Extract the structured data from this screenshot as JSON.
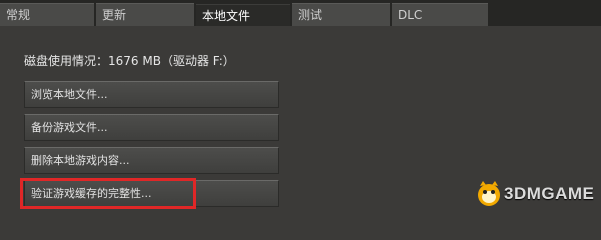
{
  "tabs": [
    {
      "label": "常规"
    },
    {
      "label": "更新"
    },
    {
      "label": "本地文件"
    },
    {
      "label": "测试"
    },
    {
      "label": "DLC"
    }
  ],
  "active_tab_index": 2,
  "disk_usage": "磁盘使用情况：1676 MB（驱动器 F:）",
  "buttons": {
    "browse": "浏览本地文件...",
    "backup": "备份游戏文件...",
    "delete": "删除本地游戏内容...",
    "verify": "验证游戏缓存的完整性..."
  },
  "watermark": {
    "text": "3DMGAME"
  },
  "colors": {
    "background": "#3b3a38",
    "tabbar": "#262624",
    "highlight": "#e02727"
  }
}
